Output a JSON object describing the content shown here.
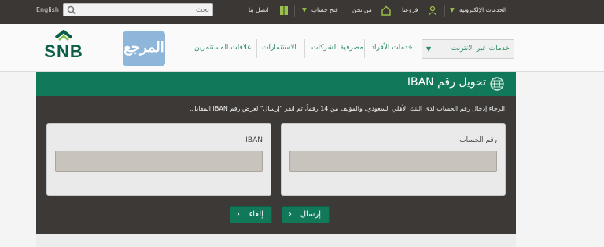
{
  "topbar": {
    "language": "English",
    "search": {
      "placeholder": "بحث"
    },
    "items": {
      "eservices": "الخدمات الإلكترونية",
      "branches": "فروعنا",
      "about": "من نحن",
      "open_account": "فتح حساب",
      "contact": "اتصل بنا"
    },
    "icons": {
      "search": "search-icon",
      "branches": "person-pin-icon",
      "home": "home-icon",
      "open_account": "book-icon"
    }
  },
  "header": {
    "logo_text": "SNB",
    "marjea_text": "المرجع",
    "dropdown_label": "خدمات عبر الانترنت",
    "nav": [
      "خدمات الأفراد",
      "مصرفية الشركات",
      "الاستثمارات",
      "علاقات المستثمرين"
    ]
  },
  "main": {
    "title": "تحويل رقم IBAN",
    "instruction": "الرجاء إدخال رقم الحساب لدى البنك الأهلي السعودي، والمؤلف من 14 رقماً، ثم انقر \"إرسال\" لعرض رقم IBAN المقابل.",
    "account_label": "رقم الحساب",
    "iban_label": "IBAN",
    "account_value": "",
    "iban_value": "",
    "submit_label": "إرسال",
    "cancel_label": "إلغاء"
  },
  "colors": {
    "brand_green": "#12785a",
    "nav_green": "#2c8c61",
    "topbar_bg": "#3b3734",
    "panel_bg": "#3d3936"
  }
}
